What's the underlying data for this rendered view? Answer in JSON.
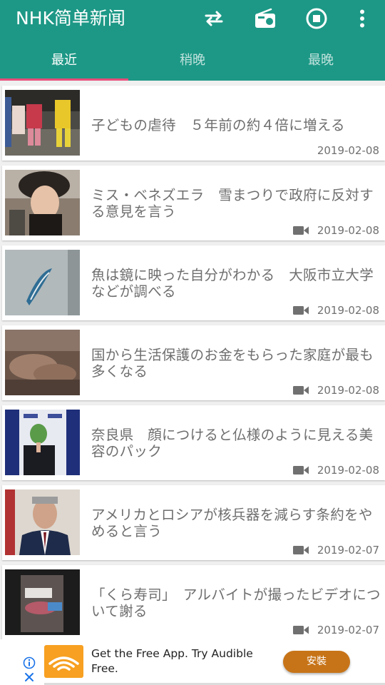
{
  "app": {
    "title": "NHK简单新闻",
    "accent_color": "#1d9886",
    "indicator_color": "#e84c7a",
    "actions": [
      "swap-icon",
      "radio-icon",
      "stop-icon",
      "more-vert-icon"
    ]
  },
  "tabs": [
    {
      "label": "最近",
      "active": true
    },
    {
      "label": "稍晚",
      "active": false
    },
    {
      "label": "最晚",
      "active": false
    }
  ],
  "articles": [
    {
      "title": "子どもの虐待　５年前の約４倍に増える",
      "date": "2019-02-08",
      "video": false
    },
    {
      "title": "ミス・ベネズエラ　雪まつりで政府に反対する意見を言う",
      "date": "2019-02-08",
      "video": true
    },
    {
      "title": "魚は鏡に映った自分がわかる　大阪市立大学などが調べる",
      "date": "2019-02-08",
      "video": true
    },
    {
      "title": "国から生活保護のお金をもらった家庭が最も多くなる",
      "date": "2019-02-08",
      "video": true
    },
    {
      "title": "奈良県　顔につけると仏様のように見える美容のパック",
      "date": "2019-02-08",
      "video": true
    },
    {
      "title": "アメリカとロシアが核兵器を減らす条約をやめると言う",
      "date": "2019-02-07",
      "video": true
    },
    {
      "title": "「くら寿司」　アルバイトが撮ったビデオについて謝る",
      "date": "2019-02-07",
      "video": true
    }
  ],
  "ad": {
    "text": "Get the Free App. Try Audible Free.",
    "button_label": "安裝",
    "button_color": "#c77418",
    "logo_color": "#f7a021"
  }
}
